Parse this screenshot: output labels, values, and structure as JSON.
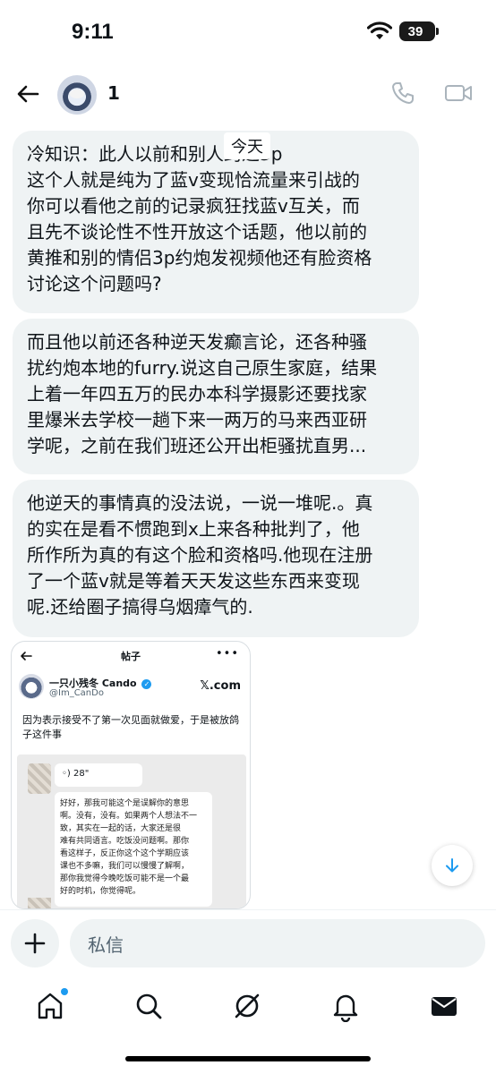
{
  "status": {
    "time": "9:11",
    "battery": "39"
  },
  "header": {
    "contact_name": "1"
  },
  "date_badge": "今天",
  "messages": [
    {
      "lines": [
        "冷知识：此人以前和别人约过3p",
        "这个人就是纯为了蓝v变现恰流量来引战的",
        "你可以看他之前的记录疯狂找蓝v互关，而",
        "且先不谈论性不性开放这个话题，他以前的",
        "黄推和别的情侣3p约炮发视频他还有脸资格",
        "讨论这个问题吗?"
      ]
    },
    {
      "lines": [
        "而且他以前还各种逆天发癫言论，还各种骚",
        "扰约炮本地的furry.说这自己原生家庭，结果",
        "上着一年四五万的民办本科学摄影还要找家",
        "里爆米去学校一趟下来一两万的马来西亚研",
        "学呢，之前在我们班还公开出柜骚扰直男..."
      ]
    },
    {
      "lines": [
        "他逆天的事情真的没法说，一说一堆呢.。真",
        "的实在是看不惯跑到x上来各种批判了，他",
        "所作所为真的有这个脸和资格吗.他现在注册",
        "了一个蓝v就是等着天天发这些东西来变现",
        "呢.还给圈子搞得乌烟瘴气的."
      ]
    }
  ],
  "shared_post": {
    "page_title": "帖子",
    "more": "•••",
    "author_name": "一只小残冬 Cando",
    "author_handle": "@Im_CanDo",
    "source": "𝕏.com",
    "text_lines": [
      "因为表示接受不了第一次见面就做爱，于是被放鸽",
      "子这件事"
    ],
    "voice_duration": "28\"",
    "inner_lines": [
      "好好，那我可能这个是误解你的意思",
      "啊。没有，没有。如果两个人想法不一",
      "致，其实在一起的话，大家还是很",
      "难有共同语言。吃饭没问题啊。那你",
      "看这样子，反正你这个这个学期应该",
      "课也不多嘛，我们可以慢慢了解啊，",
      "那你我觉得今晚吃饭可能不是一个最",
      "好的时机，你觉得呢。"
    ]
  },
  "composer": {
    "placeholder": "私信"
  },
  "colors": {
    "accent": "#1d9bf0",
    "bubble_bg": "#eff3f4",
    "text": "#0f1419",
    "muted": "#536471"
  }
}
